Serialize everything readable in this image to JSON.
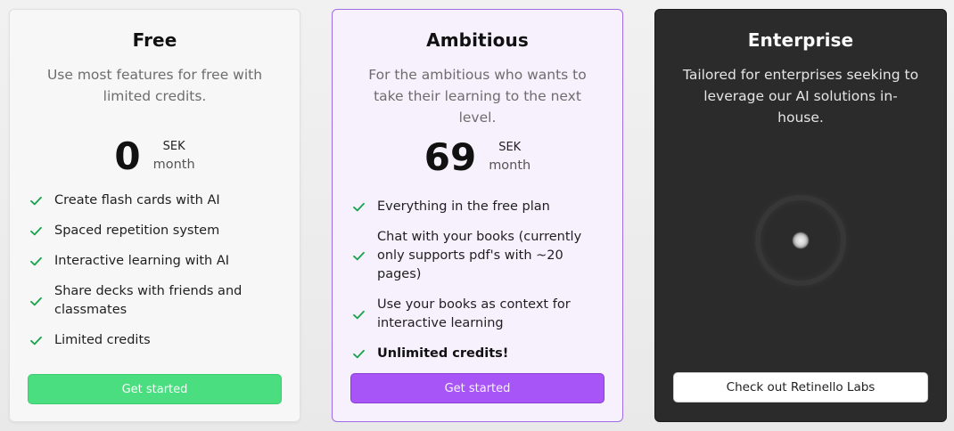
{
  "colors": {
    "free_button": "#4ade80",
    "ambitious_button": "#a855f7",
    "ambitious_border": "#a26be6",
    "enterprise_bg": "#2b2b2b",
    "check": "#16a34a"
  },
  "plans": {
    "free": {
      "title": "Free",
      "description": "Use most features for free with limited credits.",
      "price": "0",
      "currency": "SEK",
      "period": "month",
      "features": [
        "Create flash cards with AI",
        "Spaced repetition system",
        "Interactive learning with AI",
        "Share decks with friends and classmates",
        "Limited credits"
      ],
      "button": "Get started"
    },
    "ambitious": {
      "title": "Ambitious",
      "description": "For the ambitious who wants to take their learning to the next level.",
      "price": "69",
      "currency": "SEK",
      "period": "month",
      "features": [
        "Everything in the free plan",
        "Chat with your books (currently only supports pdf's with ~20 pages)",
        "Use your books as context for interactive learning",
        "Unlimited credits!"
      ],
      "button": "Get started"
    },
    "enterprise": {
      "title": "Enterprise",
      "description": "Tailored for enterprises seeking to leverage our AI solutions in-house.",
      "loading_icon": "loading-spinner",
      "button": "Check out Retinello Labs"
    }
  },
  "icons": {
    "feature_check": "check-icon"
  }
}
